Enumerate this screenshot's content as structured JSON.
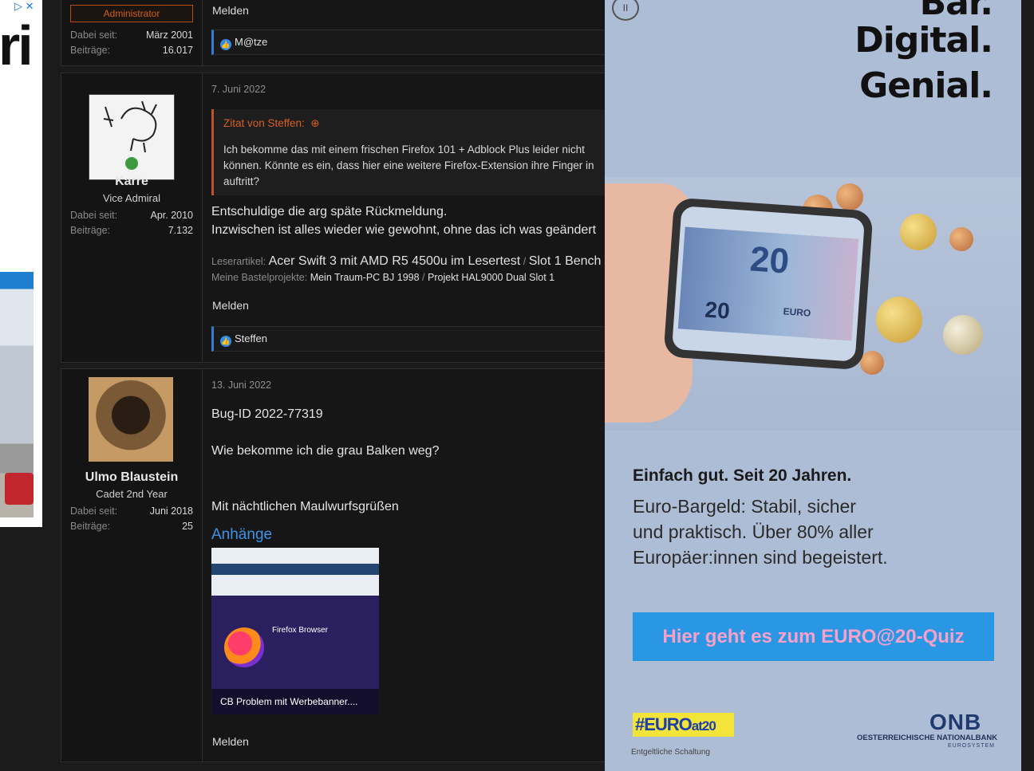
{
  "left_ad": {
    "close": "▷ ✕",
    "brand_fragment": "ri"
  },
  "posts": [
    {
      "user": {
        "badge": "Administrator",
        "joined_label": "Dabei seit:",
        "joined": "März 2001",
        "posts_label": "Beiträge:",
        "posts": "16.017"
      },
      "report": "Melden",
      "likes": "M@tze"
    },
    {
      "date": "7. Juni 2022",
      "user": {
        "name": "Karre",
        "title": "Vice Admiral",
        "joined_label": "Dabei seit:",
        "joined": "Apr. 2010",
        "posts_label": "Beiträge:",
        "posts": "7.132"
      },
      "quote": {
        "header": "Zitat von Steffen:",
        "lines": [
          "Ich bekomme das mit einem frischen Firefox 101 + Adblock Plus leider nicht",
          "können. Könnte es ein, dass hier eine weitere Firefox-Extension ihre Finger in",
          "auftritt?"
        ]
      },
      "body": [
        "Entschuldige die arg späte Rückmeldung.",
        "Inzwischen ist alles wieder wie gewohnt, ohne das ich was geändert"
      ],
      "signature": {
        "label1": "Leserartikel:",
        "value1a": "Acer Swift 3 mit AMD R5 4500u im Lesertest",
        "sep1": "/",
        "value1b": "Slot 1 Bench",
        "label2": "Meine Bastelprojekte:",
        "value2a": "Mein Traum-PC BJ 1998",
        "sep2": "/",
        "value2b": "Projekt HAL9000 Dual Slot 1"
      },
      "report": "Melden",
      "likes": "Steffen"
    },
    {
      "date": "13. Juni 2022",
      "user": {
        "name": "Ulmo Blaustein",
        "title": "Cadet 2nd Year",
        "joined_label": "Dabei seit:",
        "joined": "Juni 2018",
        "posts_label": "Beiträge:",
        "posts": "25"
      },
      "body": [
        "Bug-ID 2022-77319",
        "Wie bekomme ich die grau Balken weg?",
        "Mit nächtlichen Maulwurfsgrüßen"
      ],
      "attachments_label": "Anhänge",
      "attachment": {
        "caption": "CB Problem mit Werbebanner....",
        "inner_title": "Firefox Browser"
      },
      "report": "Melden"
    }
  ],
  "right_ad": {
    "pause": "II",
    "headline": [
      "Bar.",
      "Digital.",
      "Genial."
    ],
    "banknote": "20",
    "banknote_word": "EURO",
    "tagline": "Einfach gut. Seit 20 Jahren.",
    "copy": [
      "Euro-Bargeld: Stabil, sicher",
      "und praktisch. Über 80% aller",
      "Europäer:innen sind begeistert."
    ],
    "cta": "Hier geht es zum EURO@20-Quiz",
    "hashtag_a": "#EURO",
    "hashtag_b": "at20",
    "disclaimer": "Entgeltliche Schaltung",
    "logo": "ONB",
    "logo_sub": "OESTERREICHISCHE NATIONALBANK",
    "logo_sub2": "EUROSYSTEM",
    "colors": {
      "background": "#aebdd6",
      "cta": "#2a97e4",
      "cta_text": "#f7a0c8",
      "hashtag_bg": "#f3e43a"
    }
  }
}
